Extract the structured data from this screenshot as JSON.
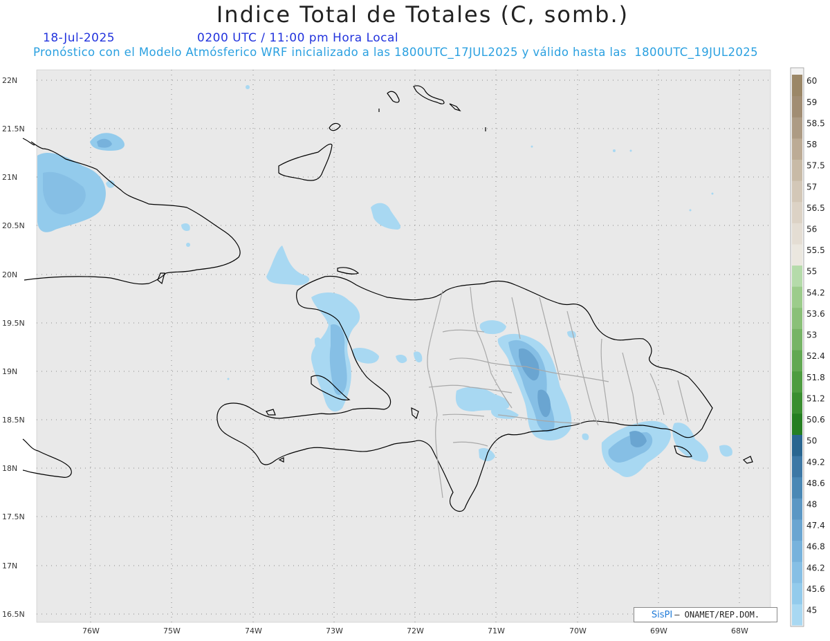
{
  "header": {
    "title": "Indice Total de Totales (C, somb.)",
    "date": "18-Jul-2025",
    "time": "0200 UTC / 11:00 pm Hora Local",
    "forecast": "Pronóstico con el Modelo Atmósferico WRF inicializado a las 1800UTC_17JUL2025 y válido hasta las  1800UTC_19JUL2025"
  },
  "map": {
    "lat_labels": [
      "22N",
      "21.5N",
      "21N",
      "20.5N",
      "20N",
      "19.5N",
      "19N",
      "18.5N",
      "18N",
      "17.5N",
      "17N",
      "16.5N"
    ],
    "lon_labels": [
      "76W",
      "75W",
      "74W",
      "73W",
      "72W",
      "71W",
      "70W",
      "69W",
      "68W"
    ],
    "background_color": "#e9e9e9",
    "coast_color": "#000000",
    "border_color": "#a8a8a8"
  },
  "legend": {
    "levels": [
      "45",
      "45.6",
      "46.2",
      "46.8",
      "47.4",
      "48",
      "48.6",
      "49.2",
      "50",
      "50.6",
      "51.2",
      "51.8",
      "52.4",
      "53",
      "53.6",
      "54.2",
      "55",
      "55.5",
      "56",
      "56.5",
      "57",
      "57.5",
      "58",
      "58.5",
      "59",
      "60"
    ],
    "colors": [
      "#a8d8f2",
      "#93cbec",
      "#86bfe5",
      "#77b2dc",
      "#6aa5d1",
      "#5b97c4",
      "#4a88b5",
      "#3d78a5",
      "#2a6690",
      "#267f22",
      "#3a8e30",
      "#4e9c40",
      "#62a852",
      "#76b465",
      "#8ac078",
      "#9ccc8b",
      "#b5dbaa",
      "#ebe7df",
      "#e4ddd3",
      "#dcd2c5",
      "#d3c7b7",
      "#c8baa6",
      "#bcab95",
      "#ad9b84",
      "#a18d73",
      "#9b8767"
    ]
  },
  "credit": {
    "brand": "SisPI",
    "org": "– ONAMET/REP.DOM."
  }
}
